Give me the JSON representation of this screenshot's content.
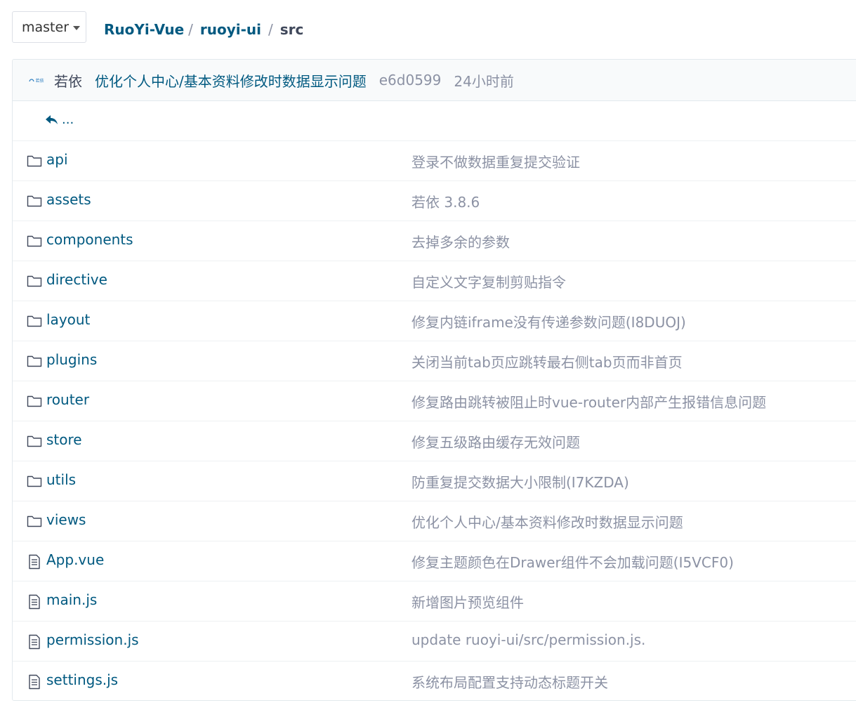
{
  "branch": {
    "label": "master"
  },
  "breadcrumb": {
    "repo": "RuoYi-Vue",
    "sep1": "/",
    "folder": "ruoyi-ui",
    "sep2": "/",
    "current": "src"
  },
  "commit": {
    "avatar_text": "若依",
    "author": "若依",
    "message": "优化个人中心/基本资料修改时数据显示问题",
    "sha": "e6d0599",
    "time": "24小时前"
  },
  "parent": {
    "label": "..."
  },
  "files": [
    {
      "name": "api",
      "type": "folder",
      "message": "登录不做数据重复提交验证"
    },
    {
      "name": "assets",
      "type": "folder",
      "message": "若依 3.8.6"
    },
    {
      "name": "components",
      "type": "folder",
      "message": "去掉多余的参数"
    },
    {
      "name": "directive",
      "type": "folder",
      "message": "自定义文字复制剪贴指令"
    },
    {
      "name": "layout",
      "type": "folder",
      "message": "修复内链iframe没有传递参数问题(I8DUOJ)"
    },
    {
      "name": "plugins",
      "type": "folder",
      "message": "关闭当前tab页应跳转最右侧tab页而非首页"
    },
    {
      "name": "router",
      "type": "folder",
      "message": "修复路由跳转被阻止时vue-router内部产生报错信息问题"
    },
    {
      "name": "store",
      "type": "folder",
      "message": "修复五级路由缓存无效问题"
    },
    {
      "name": "utils",
      "type": "folder",
      "message": "防重复提交数据大小限制(I7KZDA)"
    },
    {
      "name": "views",
      "type": "folder",
      "message": "优化个人中心/基本资料修改时数据显示问题"
    },
    {
      "name": "App.vue",
      "type": "file",
      "message": "修复主题颜色在Drawer组件不会加载问题(I5VCF0)"
    },
    {
      "name": "main.js",
      "type": "file",
      "message": "新增图片预览组件"
    },
    {
      "name": "permission.js",
      "type": "file",
      "message": "update ruoyi-ui/src/permission.js."
    },
    {
      "name": "settings.js",
      "type": "file",
      "message": "系统布局配置支持动态标题开关"
    }
  ],
  "colors": {
    "link": "#005980",
    "muted": "#8c92a4",
    "border": "#e3e9ed",
    "header_bg": "#f8fafb"
  },
  "icons": {
    "folder": "folder-icon",
    "file": "file-icon",
    "back": "reply-arrow-icon",
    "caret": "caret-down-icon"
  }
}
